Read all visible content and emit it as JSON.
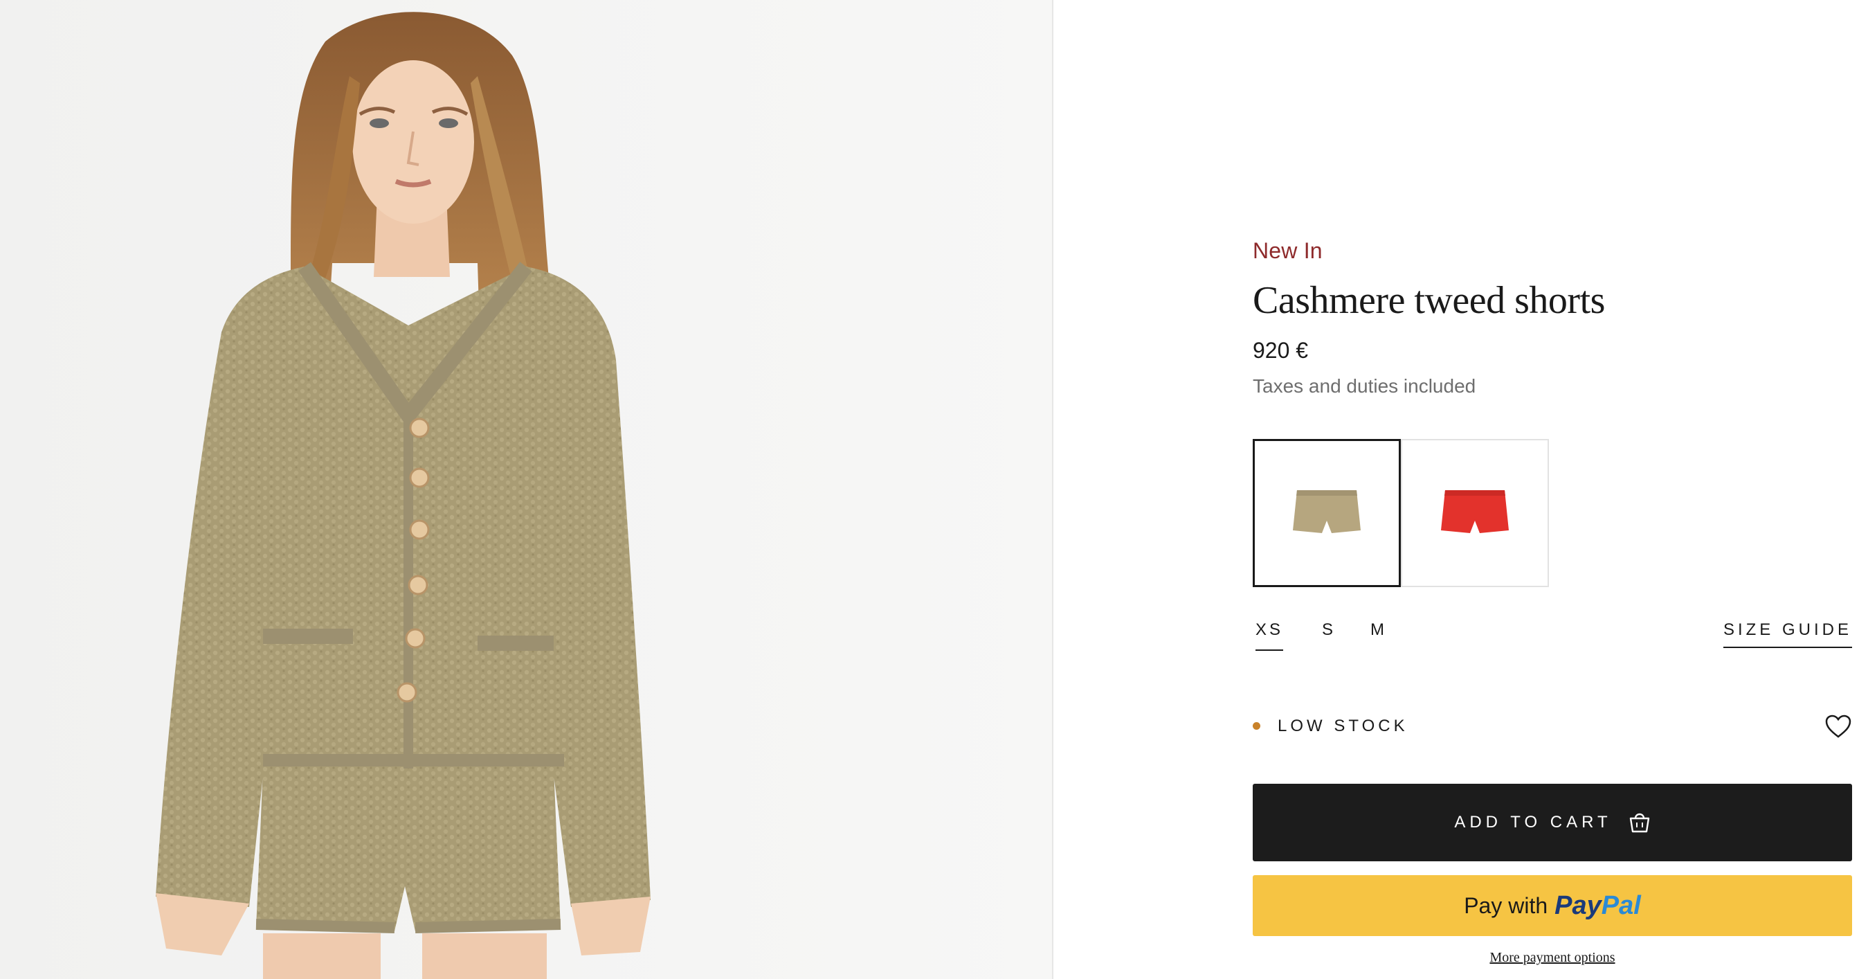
{
  "product": {
    "badge": "New In",
    "title": "Cashmere tweed shorts",
    "price": "920 €",
    "tax_note": "Taxes and duties included"
  },
  "colors": {
    "accent_badge": "#8e2a2b",
    "swatch_khaki": "#b6a67f",
    "swatch_red": "#e3322c",
    "low_stock_dot": "#c9822a",
    "cart_bg": "#1c1c1c",
    "paypal_bg": "#f6c443"
  },
  "swatches": [
    {
      "name": "khaki",
      "selected": true
    },
    {
      "name": "red",
      "selected": false
    }
  ],
  "sizes": {
    "options": [
      "XS",
      "S",
      "M"
    ],
    "selected": "XS",
    "guide_label": "SIZE GUIDE"
  },
  "stock": {
    "label": "LOW STOCK",
    "wishlist_icon": "heart-icon"
  },
  "actions": {
    "add_to_cart": "ADD TO CART",
    "cart_icon": "shopping-bag-icon",
    "paypal_prefix": "Pay with",
    "paypal_brand_1": "Pay",
    "paypal_brand_2": "Pal",
    "more_payment": "More payment options"
  }
}
